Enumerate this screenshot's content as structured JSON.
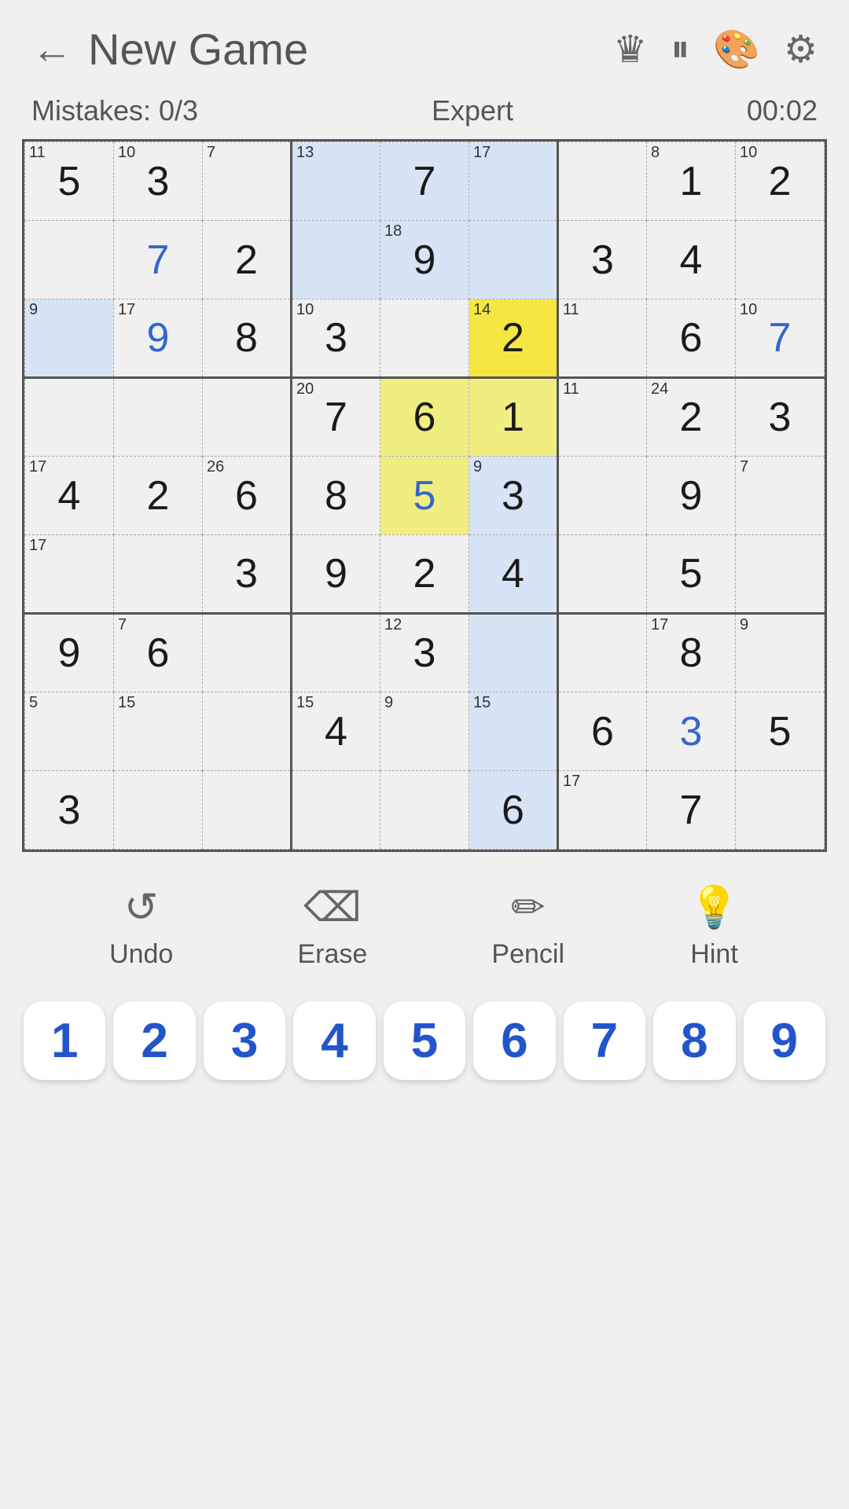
{
  "header": {
    "back_label": "←",
    "title": "New Game",
    "icons": [
      "crown",
      "pause",
      "palette",
      "settings"
    ]
  },
  "status": {
    "mistakes": "Mistakes: 0/3",
    "difficulty": "Expert",
    "time": "00:02"
  },
  "grid": {
    "cells": [
      [
        {
          "val": "5",
          "corner_tl": "11",
          "bg": "",
          "color": "black"
        },
        {
          "val": "3",
          "corner_tl": "10",
          "bg": "",
          "color": "black"
        },
        {
          "val": "",
          "corner_tl": "7",
          "bg": "",
          "color": "black"
        },
        {
          "val": "",
          "corner_tl": "13",
          "bg": "blue-light",
          "color": "black"
        },
        {
          "val": "7",
          "corner_tl": "",
          "bg": "blue-light",
          "color": "black"
        },
        {
          "val": "",
          "corner_tl": "17",
          "bg": "blue-light",
          "color": "black"
        },
        {
          "val": "",
          "corner_tl": "",
          "bg": "",
          "color": "black"
        },
        {
          "val": "1",
          "corner_tl": "8",
          "bg": "",
          "color": "black"
        },
        {
          "val": "2",
          "corner_tl": "10",
          "bg": "",
          "color": "black"
        }
      ],
      [
        {
          "val": "",
          "corner_tl": "",
          "bg": "",
          "color": "black"
        },
        {
          "val": "7",
          "corner_tl": "",
          "bg": "",
          "color": "blue"
        },
        {
          "val": "2",
          "corner_tl": "",
          "bg": "",
          "color": "black"
        },
        {
          "val": "",
          "corner_tl": "",
          "bg": "blue-light",
          "color": "black"
        },
        {
          "val": "9",
          "corner_tl": "18",
          "bg": "blue-light",
          "color": "black"
        },
        {
          "val": "",
          "corner_tl": "",
          "bg": "blue-light",
          "color": "black"
        },
        {
          "val": "3",
          "corner_tl": "",
          "bg": "",
          "color": "black"
        },
        {
          "val": "4",
          "corner_tl": "",
          "bg": "",
          "color": "black"
        },
        {
          "val": "",
          "corner_tl": "",
          "bg": "",
          "color": "black"
        }
      ],
      [
        {
          "val": "",
          "corner_tl": "9",
          "bg": "blue-light",
          "color": "black"
        },
        {
          "val": "9",
          "corner_tl": "17",
          "bg": "",
          "color": "blue"
        },
        {
          "val": "8",
          "corner_tl": "",
          "bg": "",
          "color": "black"
        },
        {
          "val": "3",
          "corner_tl": "10",
          "bg": "",
          "color": "black"
        },
        {
          "val": "",
          "corner_tl": "",
          "bg": "",
          "color": "black"
        },
        {
          "val": "2",
          "corner_tl": "14",
          "bg": "yellow",
          "color": "black"
        },
        {
          "val": "",
          "corner_tl": "11",
          "bg": "",
          "color": "black"
        },
        {
          "val": "6",
          "corner_tl": "",
          "bg": "",
          "color": "black"
        },
        {
          "val": "7",
          "corner_tl": "10",
          "bg": "",
          "color": "blue"
        }
      ],
      [
        {
          "val": "",
          "corner_tl": "",
          "bg": "",
          "color": "black"
        },
        {
          "val": "",
          "corner_tl": "",
          "bg": "",
          "color": "black"
        },
        {
          "val": "",
          "corner_tl": "",
          "bg": "",
          "color": "black"
        },
        {
          "val": "7",
          "corner_tl": "20",
          "bg": "",
          "color": "black"
        },
        {
          "val": "6",
          "corner_tl": "",
          "bg": "yellow-light",
          "color": "black"
        },
        {
          "val": "1",
          "corner_tl": "",
          "bg": "yellow-light",
          "color": "black"
        },
        {
          "val": "",
          "corner_tl": "11",
          "bg": "",
          "color": "black"
        },
        {
          "val": "2",
          "corner_tl": "24",
          "bg": "",
          "color": "black"
        },
        {
          "val": "3",
          "corner_tl": "",
          "bg": "",
          "color": "black"
        }
      ],
      [
        {
          "val": "4",
          "corner_tl": "17",
          "bg": "",
          "color": "black"
        },
        {
          "val": "2",
          "corner_tl": "",
          "bg": "",
          "color": "black"
        },
        {
          "val": "6",
          "corner_tl": "26",
          "bg": "",
          "color": "black"
        },
        {
          "val": "8",
          "corner_tl": "",
          "bg": "",
          "color": "black"
        },
        {
          "val": "5",
          "corner_tl": "",
          "bg": "yellow-light",
          "color": "blue"
        },
        {
          "val": "3",
          "corner_tl": "9",
          "bg": "blue-light",
          "color": "black"
        },
        {
          "val": "",
          "corner_tl": "",
          "bg": "",
          "color": "black"
        },
        {
          "val": "9",
          "corner_tl": "",
          "bg": "",
          "color": "black"
        },
        {
          "val": "",
          "corner_tl": "7",
          "bg": "",
          "color": "black"
        }
      ],
      [
        {
          "val": "",
          "corner_tl": "17",
          "bg": "",
          "color": "black"
        },
        {
          "val": "",
          "corner_tl": "",
          "bg": "",
          "color": "black"
        },
        {
          "val": "3",
          "corner_tl": "",
          "bg": "",
          "color": "black"
        },
        {
          "val": "9",
          "corner_tl": "",
          "bg": "",
          "color": "black"
        },
        {
          "val": "2",
          "corner_tl": "",
          "bg": "",
          "color": "black"
        },
        {
          "val": "4",
          "corner_tl": "",
          "bg": "blue-light",
          "color": "black"
        },
        {
          "val": "",
          "corner_tl": "",
          "bg": "",
          "color": "black"
        },
        {
          "val": "5",
          "corner_tl": "",
          "bg": "",
          "color": "black"
        },
        {
          "val": "",
          "corner_tl": "",
          "bg": "",
          "color": "black"
        }
      ],
      [
        {
          "val": "9",
          "corner_tl": "",
          "bg": "",
          "color": "black"
        },
        {
          "val": "6",
          "corner_tl": "7",
          "bg": "",
          "color": "black"
        },
        {
          "val": "",
          "corner_tl": "",
          "bg": "",
          "color": "black"
        },
        {
          "val": "",
          "corner_tl": "",
          "bg": "",
          "color": "black"
        },
        {
          "val": "3",
          "corner_tl": "12",
          "bg": "",
          "color": "black"
        },
        {
          "val": "",
          "corner_tl": "",
          "bg": "blue-light",
          "color": "black"
        },
        {
          "val": "",
          "corner_tl": "",
          "bg": "",
          "color": "black"
        },
        {
          "val": "8",
          "corner_tl": "17",
          "bg": "",
          "color": "black"
        },
        {
          "val": "",
          "corner_tl": "9",
          "bg": "",
          "color": "black"
        }
      ],
      [
        {
          "val": "",
          "corner_tl": "5",
          "bg": "",
          "color": "black"
        },
        {
          "val": "",
          "corner_tl": "15",
          "bg": "",
          "color": "black"
        },
        {
          "val": "",
          "corner_tl": "",
          "bg": "",
          "color": "black"
        },
        {
          "val": "4",
          "corner_tl": "15",
          "bg": "",
          "color": "black"
        },
        {
          "val": "",
          "corner_tl": "9",
          "bg": "",
          "color": "black"
        },
        {
          "val": "",
          "corner_tl": "15",
          "bg": "blue-light",
          "color": "black"
        },
        {
          "val": "6",
          "corner_tl": "",
          "bg": "",
          "color": "black"
        },
        {
          "val": "3",
          "corner_tl": "",
          "bg": "",
          "color": "blue"
        },
        {
          "val": "5",
          "corner_tl": "",
          "bg": "",
          "color": "black"
        }
      ],
      [
        {
          "val": "3",
          "corner_tl": "",
          "bg": "",
          "color": "black"
        },
        {
          "val": "",
          "corner_tl": "",
          "bg": "",
          "color": "black"
        },
        {
          "val": "",
          "corner_tl": "",
          "bg": "",
          "color": "black"
        },
        {
          "val": "",
          "corner_tl": "",
          "bg": "",
          "color": "black"
        },
        {
          "val": "",
          "corner_tl": "",
          "bg": "",
          "color": "black"
        },
        {
          "val": "6",
          "corner_tl": "",
          "bg": "blue-light",
          "color": "black"
        },
        {
          "val": "",
          "corner_tl": "17",
          "bg": "",
          "color": "black"
        },
        {
          "val": "7",
          "corner_tl": "",
          "bg": "",
          "color": "black"
        },
        {
          "val": "",
          "corner_tl": "",
          "bg": "",
          "color": "black"
        }
      ]
    ]
  },
  "toolbar": {
    "undo_label": "Undo",
    "erase_label": "Erase",
    "pencil_label": "Pencil",
    "hint_label": "Hint"
  },
  "numpad": {
    "numbers": [
      "1",
      "2",
      "3",
      "4",
      "5",
      "6",
      "7",
      "8",
      "9"
    ]
  }
}
